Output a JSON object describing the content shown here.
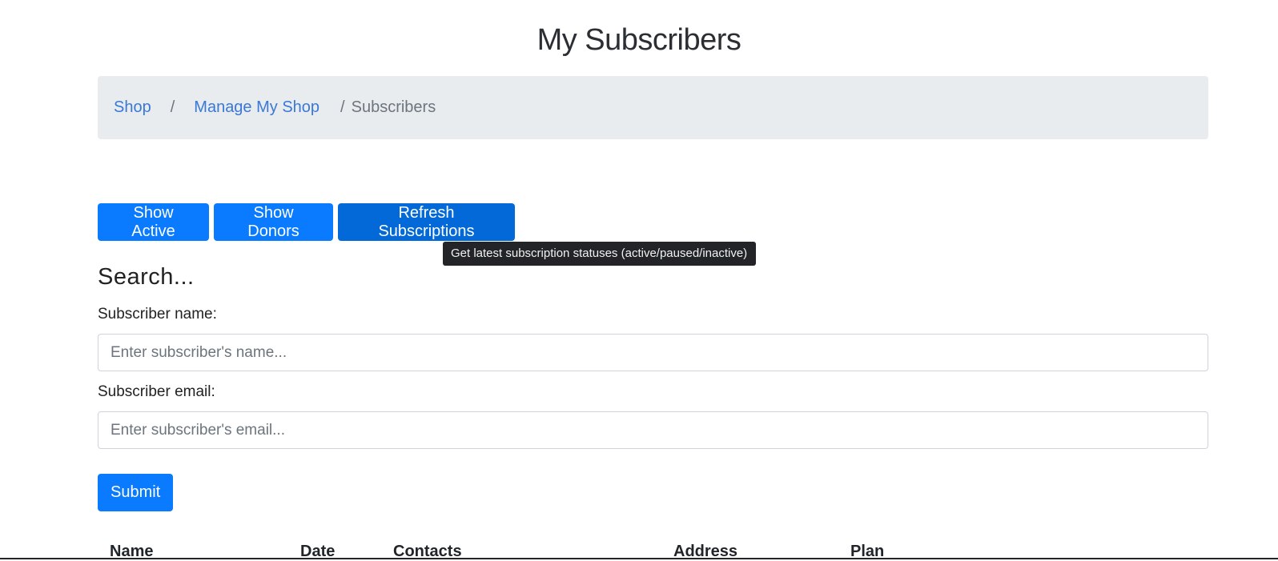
{
  "page": {
    "title": "My Subscribers"
  },
  "breadcrumb": {
    "items": [
      {
        "label": "Shop"
      },
      {
        "label": "Manage My Shop"
      },
      {
        "label": "Subscribers"
      }
    ],
    "separator": "/"
  },
  "actions": {
    "show_active_label": "Show Active",
    "show_donors_label": "Show Donors",
    "refresh_label": "Refresh Subscriptions",
    "refresh_tooltip": "Get latest subscription statuses (active/paused/inactive)"
  },
  "search": {
    "heading": "Search...",
    "name_label": "Subscriber name:",
    "name_placeholder": "Enter subscriber's name...",
    "email_label": "Subscriber email:",
    "email_placeholder": "Enter subscriber's email...",
    "submit_label": "Submit"
  },
  "table": {
    "columns": [
      "Name",
      "Date",
      "Contacts",
      "Address",
      "Plan"
    ]
  },
  "colors": {
    "primary": "#0a7bff",
    "primary_hover": "#0369d9",
    "breadcrumb_bg": "#e9ecef",
    "link": "#3a78d6",
    "tooltip_bg": "#222428"
  }
}
